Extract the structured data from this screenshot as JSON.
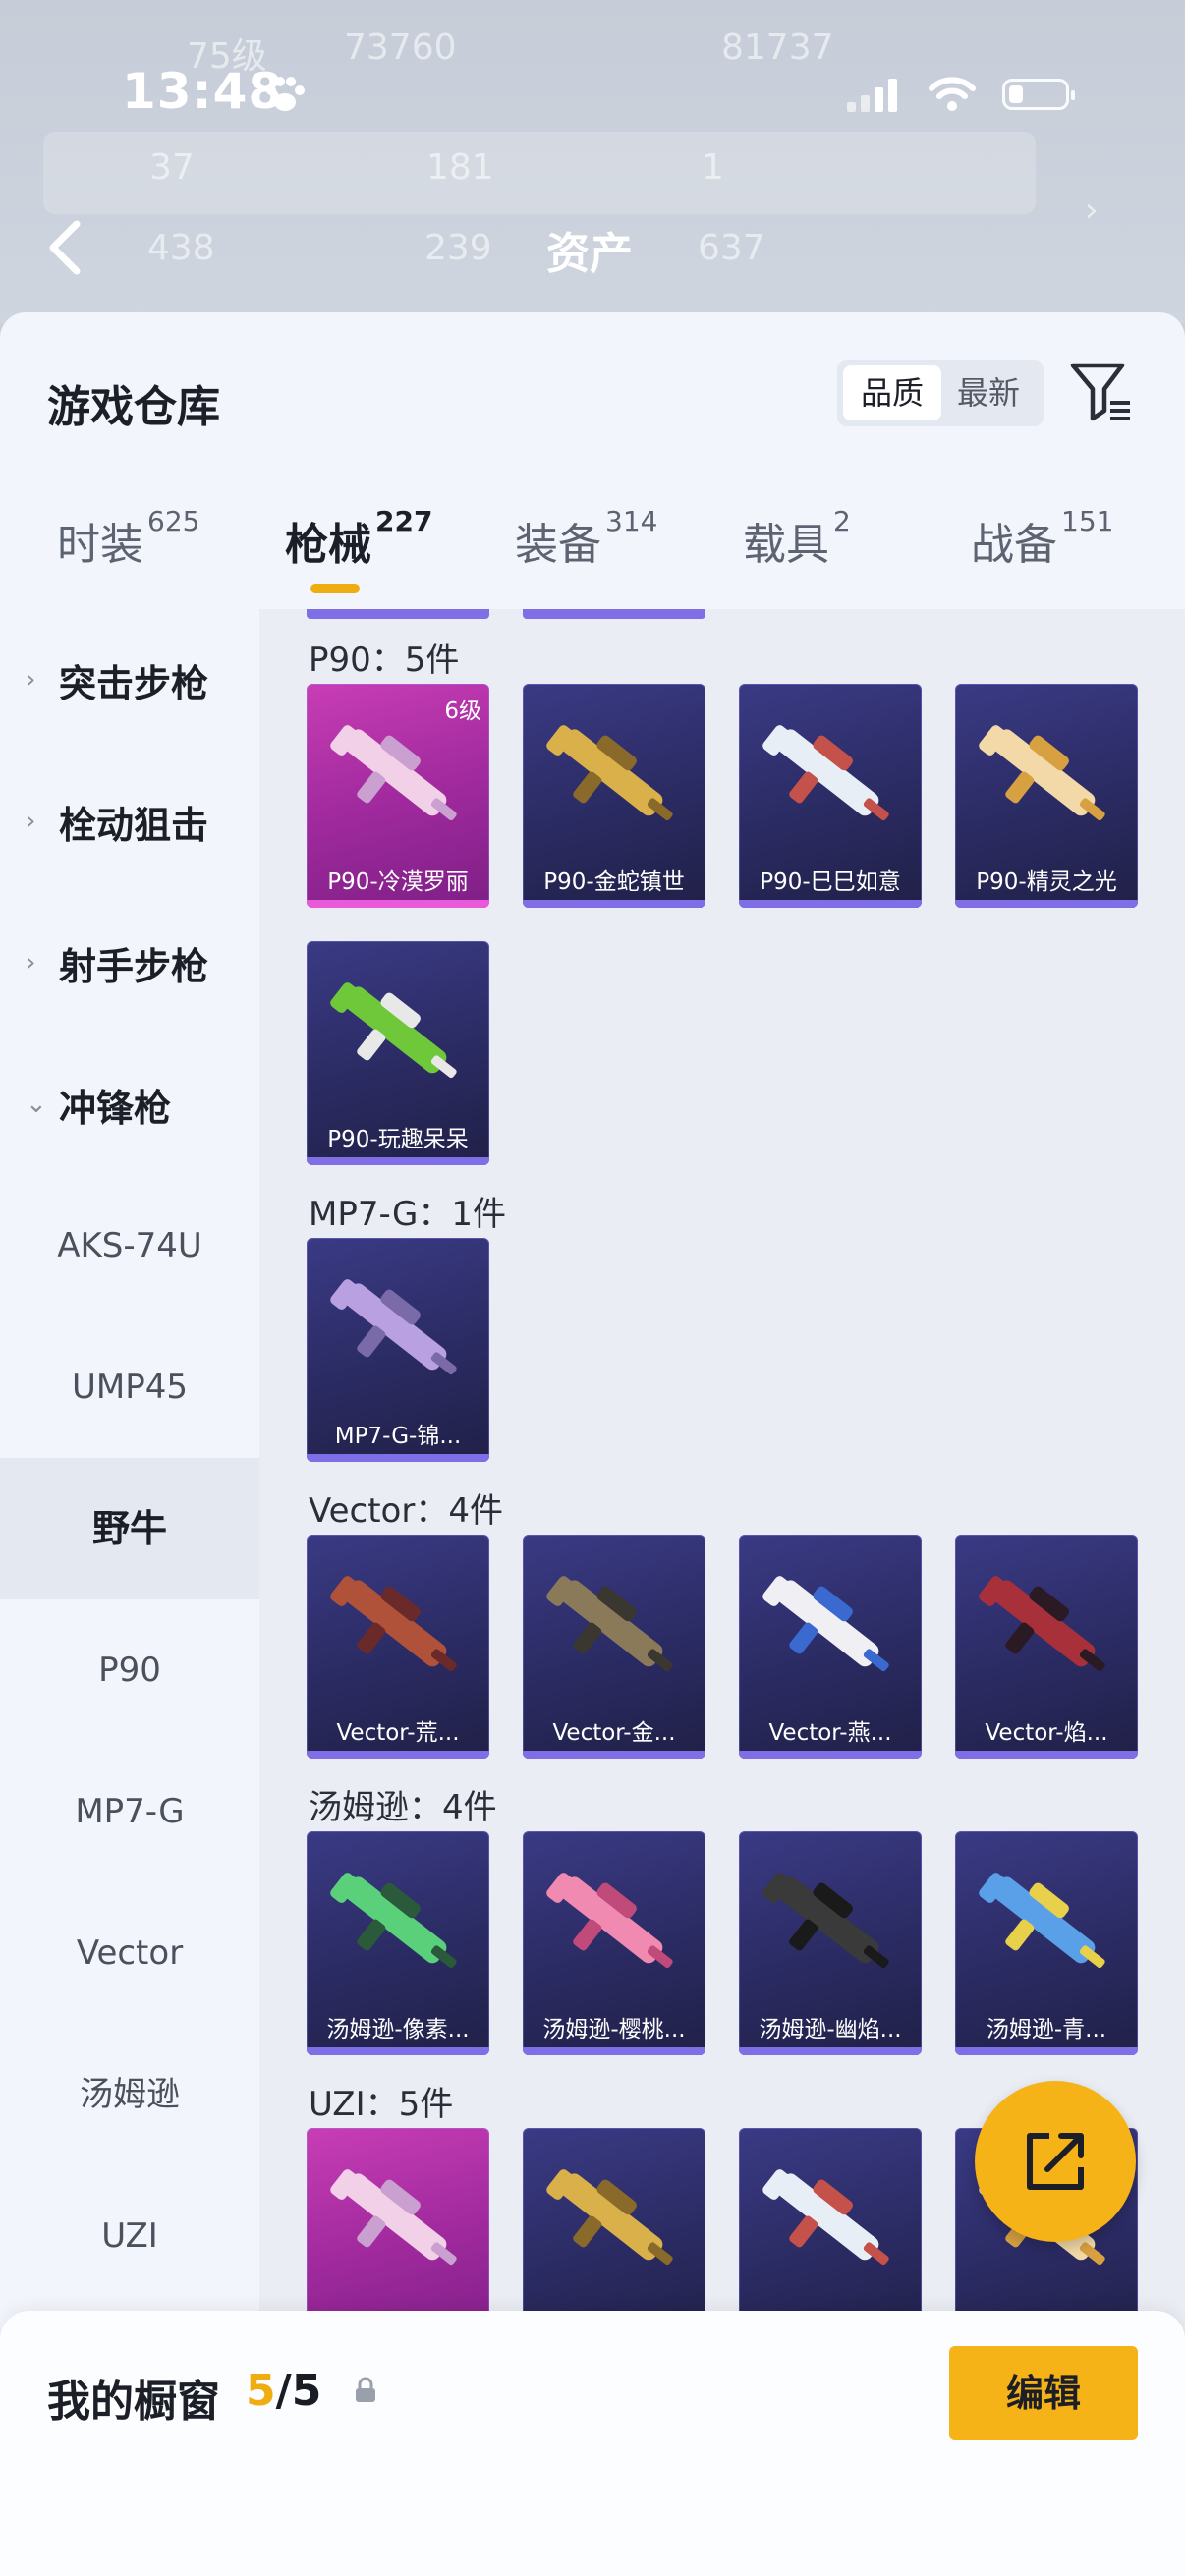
{
  "status_bar": {
    "time": "13:48"
  },
  "background_header": {
    "faded_level": "75级",
    "faded_value_1": "73760",
    "faded_value_2": "81737",
    "stats": [
      "37",
      "181",
      "1",
      "438",
      "239",
      "637"
    ],
    "title": "资产"
  },
  "sheet": {
    "title": "游戏仓库",
    "sort_options": [
      "品质",
      "最新"
    ],
    "sort_selected": "品质"
  },
  "tabs": [
    {
      "label": "时装",
      "count": "625"
    },
    {
      "label": "枪械",
      "count": "227"
    },
    {
      "label": "装备",
      "count": "314"
    },
    {
      "label": "载具",
      "count": "2"
    },
    {
      "label": "战备",
      "count": "151"
    }
  ],
  "active_tab": "枪械",
  "sidebar": {
    "categories": [
      {
        "label": "突击步枪",
        "expanded": false
      },
      {
        "label": "栓动狙击",
        "expanded": false
      },
      {
        "label": "射手步枪",
        "expanded": false
      },
      {
        "label": "冲锋枪",
        "expanded": true
      }
    ],
    "sub_items": [
      "AKS-74U",
      "UMP45",
      "野牛",
      "P90",
      "MP7-G",
      "Vector",
      "汤姆逊",
      "UZI"
    ],
    "selected": "野牛"
  },
  "groups": [
    {
      "title": "P90：5件",
      "items": [
        {
          "name": "P90-冷漠罗丽",
          "level": "6级",
          "rarity": "pink"
        },
        {
          "name": "P90-金蛇镇世",
          "rarity": "purple"
        },
        {
          "name": "P90-巳巳如意",
          "rarity": "purple"
        },
        {
          "name": "P90-精灵之光",
          "rarity": "purple"
        },
        {
          "name": "P90-玩趣呆呆",
          "rarity": "purple"
        }
      ]
    },
    {
      "title": "MP7-G：1件",
      "items": [
        {
          "name": "MP7-G-锦...",
          "rarity": "purple"
        }
      ]
    },
    {
      "title": "Vector：4件",
      "items": [
        {
          "name": "Vector-荒...",
          "rarity": "purple"
        },
        {
          "name": "Vector-金...",
          "rarity": "purple"
        },
        {
          "name": "Vector-燕...",
          "rarity": "purple"
        },
        {
          "name": "Vector-焰...",
          "rarity": "purple"
        }
      ]
    },
    {
      "title": "汤姆逊：4件",
      "items": [
        {
          "name": "汤姆逊-像素...",
          "rarity": "purple"
        },
        {
          "name": "汤姆逊-樱桃...",
          "rarity": "purple"
        },
        {
          "name": "汤姆逊-幽焰...",
          "rarity": "purple"
        },
        {
          "name": "汤姆逊-青...",
          "rarity": "purple"
        }
      ]
    },
    {
      "title": "UZI：5件",
      "items": []
    }
  ],
  "bottom_bar": {
    "label": "我的橱窗",
    "count_current": "5",
    "count_separator": "/",
    "count_total": "5",
    "edit_label": "编辑"
  },
  "colors": {
    "accent": "#f6b318",
    "card_purple": "#2c2c66",
    "card_pink": "#a12a9e",
    "sheet_bg": "#f2f5fb"
  }
}
